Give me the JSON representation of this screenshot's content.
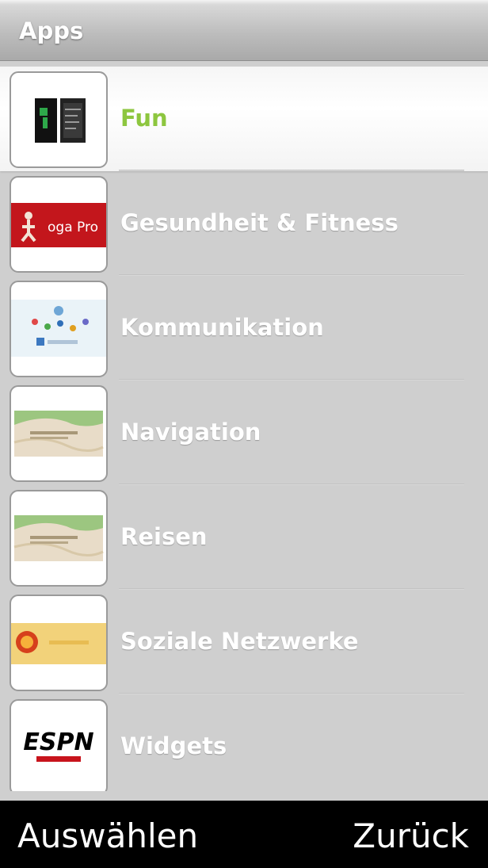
{
  "header": {
    "title": "Apps"
  },
  "categories": [
    {
      "label": "Fun",
      "selected": true,
      "icon": "fun-app-icon"
    },
    {
      "label": "Gesundheit & Fitness",
      "selected": false,
      "icon": "yoga-pro-icon",
      "thumb_text": "oga Pro"
    },
    {
      "label": "Kommunikation",
      "selected": false,
      "icon": "communication-app-icon"
    },
    {
      "label": "Navigation",
      "selected": false,
      "icon": "map-app-icon"
    },
    {
      "label": "Reisen",
      "selected": false,
      "icon": "map-app-icon"
    },
    {
      "label": "Soziale Netzwerke",
      "selected": false,
      "icon": "social-app-icon"
    },
    {
      "label": "Widgets",
      "selected": false,
      "icon": "espn-logo-icon",
      "thumb_text": "ESPN"
    }
  ],
  "softkeys": {
    "left": "Auswählen",
    "right": "Zurück"
  },
  "colors": {
    "selected_label": "#8dc63f",
    "list_background": "#cfcfcf",
    "softkey_bar": "#000000"
  }
}
